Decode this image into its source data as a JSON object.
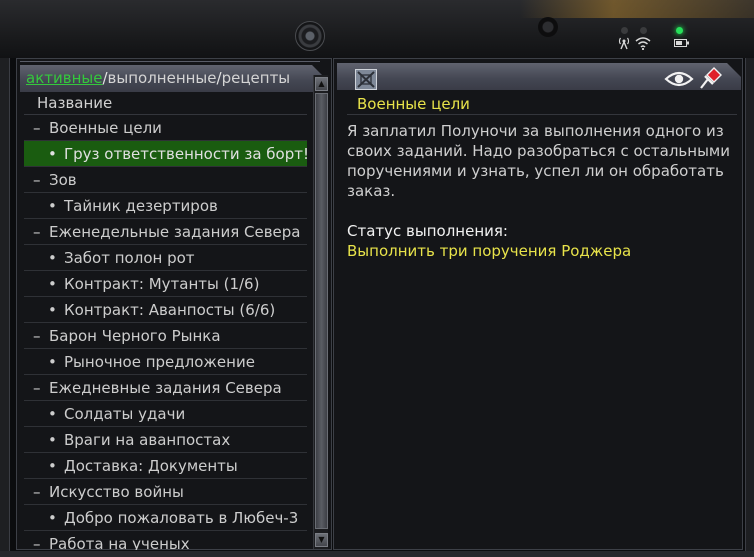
{
  "list_panel": {
    "tabs": {
      "active": "активные",
      "completed": "выполненные",
      "recipes": "рецепты",
      "separator": "/"
    },
    "column_header": "Название",
    "rows": [
      {
        "kind": "group",
        "prefix": "–",
        "label": "Военные цели"
      },
      {
        "kind": "item",
        "prefix": "•",
        "label": "Груз ответственности за борт!",
        "selected": true
      },
      {
        "kind": "group",
        "prefix": "–",
        "label": "Зов"
      },
      {
        "kind": "item",
        "prefix": "•",
        "label": "Тайник дезертиров"
      },
      {
        "kind": "group",
        "prefix": "–",
        "label": "Еженедельные задания Севера"
      },
      {
        "kind": "item",
        "prefix": "•",
        "label": "Забот полон рот"
      },
      {
        "kind": "item",
        "prefix": "•",
        "label": "Контракт: Мутанты (1/6)"
      },
      {
        "kind": "item",
        "prefix": "•",
        "label": "Контракт: Аванпосты (6/6)"
      },
      {
        "kind": "group",
        "prefix": "–",
        "label": "Барон Черного Рынка"
      },
      {
        "kind": "item",
        "prefix": "•",
        "label": "Рыночное предложение"
      },
      {
        "kind": "group",
        "prefix": "–",
        "label": "Ежедневные задания Севера"
      },
      {
        "kind": "item",
        "prefix": "•",
        "label": "Солдаты удачи"
      },
      {
        "kind": "item",
        "prefix": "•",
        "label": "Враги на аванпостах"
      },
      {
        "kind": "item",
        "prefix": "•",
        "label": "Доставка: Документы"
      },
      {
        "kind": "group",
        "prefix": "–",
        "label": "Искусство войны"
      },
      {
        "kind": "item",
        "prefix": "•",
        "label": "Добро пожаловать в Любеч-3"
      },
      {
        "kind": "group",
        "prefix": "–",
        "label": "Работа на ученых"
      }
    ]
  },
  "detail_panel": {
    "title": "Военные цели",
    "description": "Я заплатил Полуночи за выполнения одного из своих заданий. Надо разобраться с остальными поручениями и узнать, успел ли он обработать заказ.",
    "status_label": "Статус выполнения:",
    "objective": "Выполнить три поручения Роджера"
  },
  "icons": {
    "quest_type": "quest-type-icon",
    "track": "eye-icon",
    "pin": "pin-icon",
    "signal": "antenna-icon",
    "wifi": "wifi-icon",
    "battery": "battery-icon"
  },
  "colors": {
    "active_tab": "#35c83d",
    "selected_row": "#1a5c10",
    "title_yellow": "#e8e34a",
    "status_led": "#27e05a",
    "pin_red": "#e0202a"
  }
}
